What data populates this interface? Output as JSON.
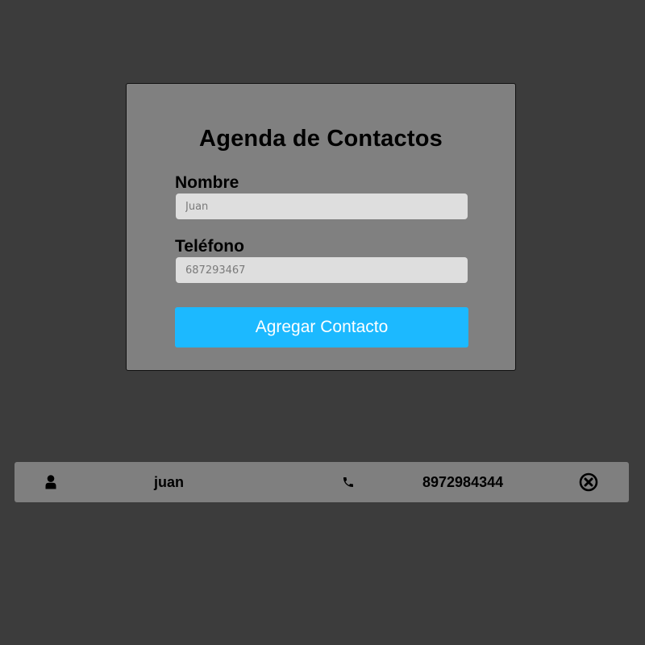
{
  "form": {
    "title": "Agenda de Contactos",
    "name_label": "Nombre",
    "name_placeholder": "Juan",
    "phone_label": "Teléfono",
    "phone_placeholder": "687293467",
    "submit_label": "Agregar Contacto"
  },
  "contacts": [
    {
      "name": "juan",
      "phone": "8972984344",
      "user_icon": "user-icon",
      "phone_icon": "phone-icon",
      "delete_icon": "close-circle-icon"
    }
  ],
  "colors": {
    "background": "#3c3c3c",
    "card": "#808080",
    "input": "#dedede",
    "accent": "#1cb9ff",
    "row": "#7f7f7f"
  }
}
